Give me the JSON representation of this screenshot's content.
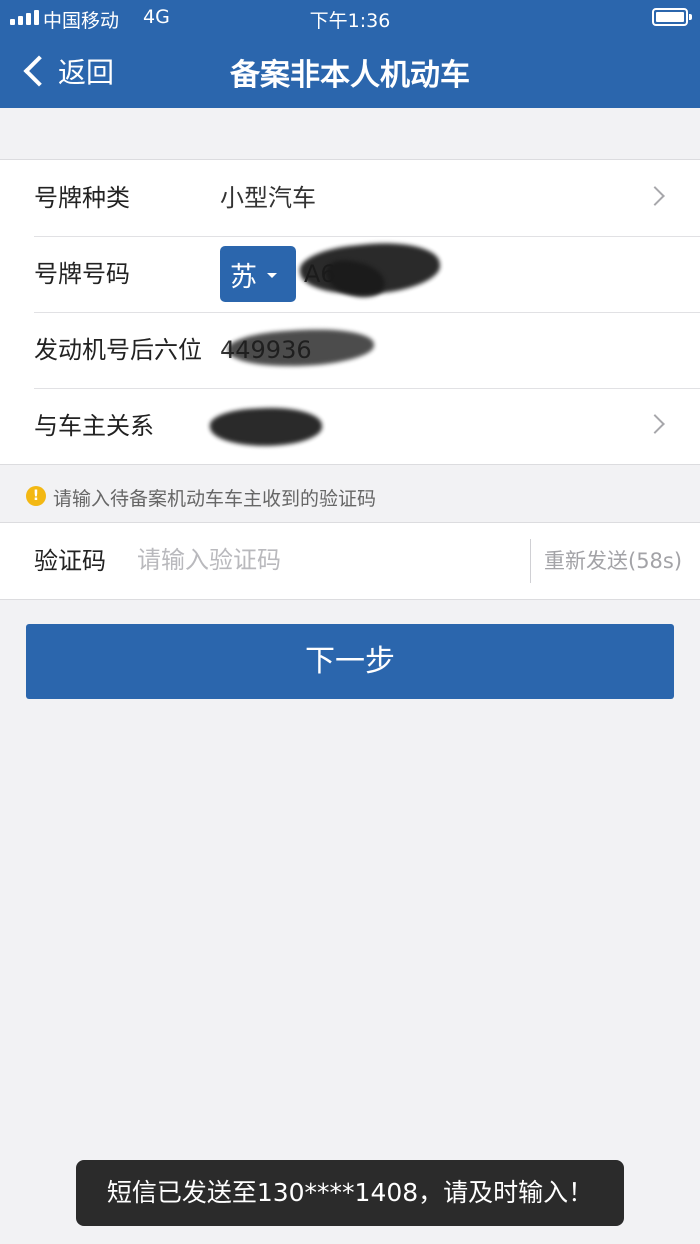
{
  "status_bar": {
    "carrier": "中国移动",
    "network": "4G",
    "time": "下午1:36"
  },
  "nav": {
    "back_label": "返回",
    "title": "备案非本人机动车"
  },
  "form": {
    "plate_type": {
      "label": "号牌种类",
      "value": "小型汽车"
    },
    "plate_number": {
      "label": "号牌号码",
      "province": "苏",
      "visible_prefix": "A6"
    },
    "engine_number": {
      "label": "发动机号后六位",
      "value": "449936"
    },
    "relation": {
      "label": "与车主关系"
    }
  },
  "hint": {
    "icon": "!",
    "text": "请输入待备案机动车车主收到的验证码"
  },
  "verification": {
    "label": "验证码",
    "placeholder": "请输入验证码",
    "resend": "重新发送(58s)"
  },
  "next_button": "下一步",
  "toast": "短信已发送至130****1408，请及时输入！",
  "colors": {
    "primary": "#2b66ad",
    "background": "#f2f2f4",
    "warning": "#f3b813"
  }
}
